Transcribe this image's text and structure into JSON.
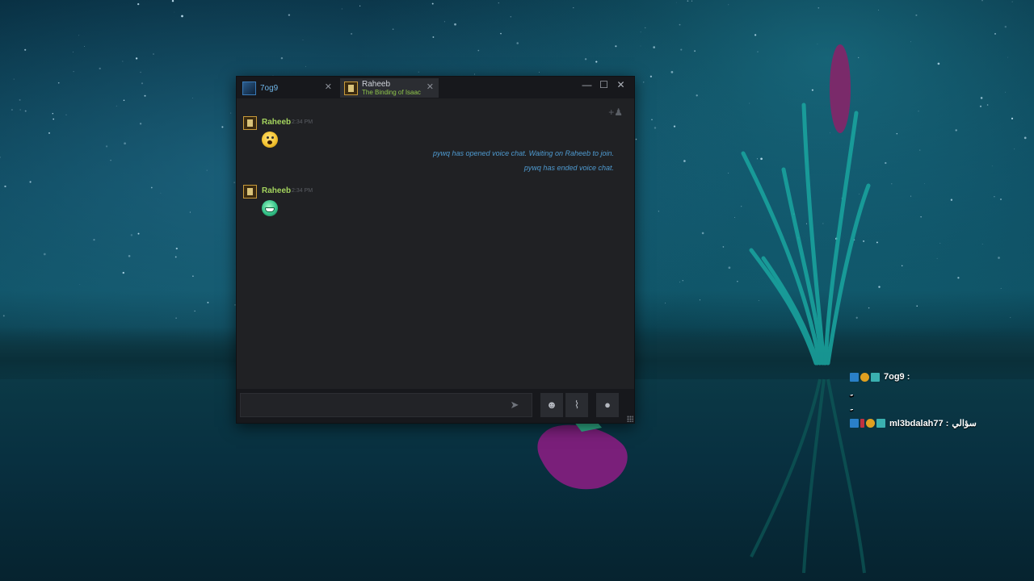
{
  "window": {
    "tabs": [
      {
        "name": "7og9",
        "game": ""
      },
      {
        "name": "Raheeb",
        "game": "The Binding of Isaac"
      }
    ],
    "controls": {
      "minimize": "—",
      "maximize": "☐",
      "close": "✕"
    },
    "tab_close": "✕"
  },
  "messages": {
    "groups": [
      {
        "author": "Raheeb",
        "time": "2:34 PM",
        "emoticon": "surprised-emoticon"
      },
      {
        "author": "Raheeb",
        "time": "2:34 PM",
        "emoticon": "grin-emoticon"
      }
    ],
    "system": [
      "pywq has opened voice chat. Waiting on Raheeb to join.",
      "pywq has ended voice chat."
    ]
  },
  "composer": {
    "input_value": "",
    "send_glyph": "➤",
    "emoticon_glyph": "☻",
    "attach_glyph": "⌇",
    "voice_glyph": "●"
  },
  "overlay": {
    "lines": [
      {
        "user": "7og9 :",
        "text": ""
      },
      {
        "user": "",
        "text": "ِِِِِِِِِِِِِِِِِِِِِِِِِِِِِِِِِِِِِِِِِِِِِِِِِِ"
      },
      {
        "user": "",
        "text": "ِِِِِِِِِِِ"
      },
      {
        "user": "ml3bdalah77 :",
        "text": "سؤالي"
      }
    ]
  }
}
